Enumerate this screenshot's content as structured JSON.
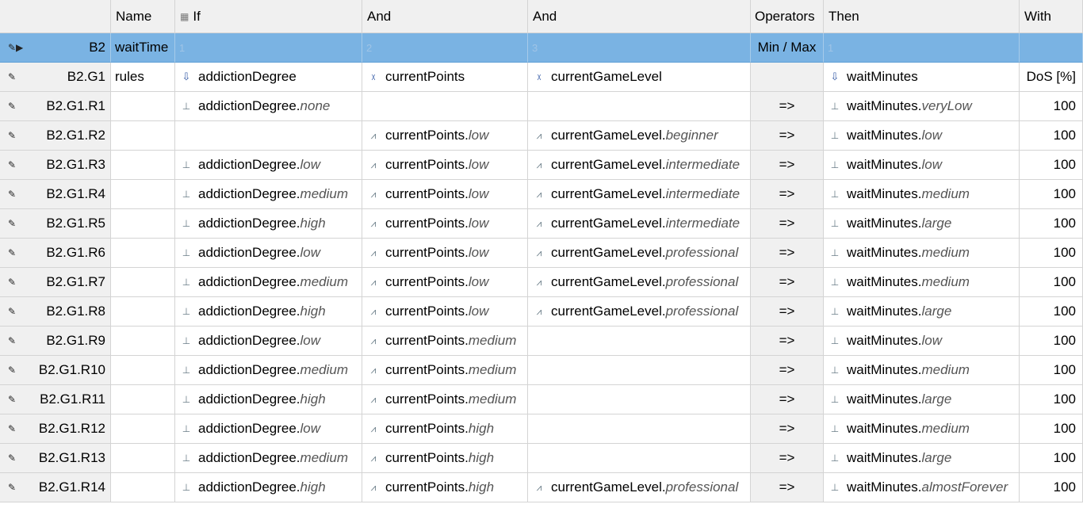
{
  "columns": {
    "name": "Name",
    "if": "If",
    "and1": "And",
    "and2": "And",
    "operators": "Operators",
    "then": "Then",
    "with": "With"
  },
  "block": {
    "id": "B2",
    "name": "waitTime",
    "if_num": "1",
    "and1_num": "2",
    "and2_num": "3",
    "operator": "Min / Max",
    "then_num": "1"
  },
  "group": {
    "id": "B2.G1",
    "name": "rules",
    "if_var": "addictionDegree",
    "and1_var": "currentPoints",
    "and2_var": "currentGameLevel",
    "then_var": "waitMinutes",
    "with_label": "DoS [%]"
  },
  "icons": {
    "edit": "pencil-icon",
    "current_row": "current-row-arrow-icon",
    "input_variable": "input-variable-icon",
    "fuzzy_variable": "fuzzy-variable-icon",
    "term": "membership-function-icon",
    "column_grip": "column-grip-icon"
  },
  "rules": [
    {
      "id": "B2.G1.R1",
      "c_if": "addictionDegree.",
      "t_if": "none",
      "c_a1": "",
      "t_a1": "",
      "c_a2": "",
      "t_a2": "",
      "op": "=>",
      "c_then": "waitMinutes.",
      "t_then": "veryLow",
      "dos": "100"
    },
    {
      "id": "B2.G1.R2",
      "c_if": "",
      "t_if": "",
      "c_a1": "currentPoints.",
      "t_a1": "low",
      "c_a2": "currentGameLevel.",
      "t_a2": "beginner",
      "op": "=>",
      "c_then": "waitMinutes.",
      "t_then": "low",
      "dos": "100"
    },
    {
      "id": "B2.G1.R3",
      "c_if": "addictionDegree.",
      "t_if": "low",
      "c_a1": "currentPoints.",
      "t_a1": "low",
      "c_a2": "currentGameLevel.",
      "t_a2": "intermediate",
      "op": "=>",
      "c_then": "waitMinutes.",
      "t_then": "low",
      "dos": "100"
    },
    {
      "id": "B2.G1.R4",
      "c_if": "addictionDegree.",
      "t_if": "medium",
      "c_a1": "currentPoints.",
      "t_a1": "low",
      "c_a2": "currentGameLevel.",
      "t_a2": "intermediate",
      "op": "=>",
      "c_then": "waitMinutes.",
      "t_then": "medium",
      "dos": "100"
    },
    {
      "id": "B2.G1.R5",
      "c_if": "addictionDegree.",
      "t_if": "high",
      "c_a1": "currentPoints.",
      "t_a1": "low",
      "c_a2": "currentGameLevel.",
      "t_a2": "intermediate",
      "op": "=>",
      "c_then": "waitMinutes.",
      "t_then": "large",
      "dos": "100"
    },
    {
      "id": "B2.G1.R6",
      "c_if": "addictionDegree.",
      "t_if": "low",
      "c_a1": "currentPoints.",
      "t_a1": "low",
      "c_a2": "currentGameLevel.",
      "t_a2": "professional",
      "op": "=>",
      "c_then": "waitMinutes.",
      "t_then": "medium",
      "dos": "100"
    },
    {
      "id": "B2.G1.R7",
      "c_if": "addictionDegree.",
      "t_if": "medium",
      "c_a1": "currentPoints.",
      "t_a1": "low",
      "c_a2": "currentGameLevel.",
      "t_a2": "professional",
      "op": "=>",
      "c_then": "waitMinutes.",
      "t_then": "medium",
      "dos": "100"
    },
    {
      "id": "B2.G1.R8",
      "c_if": "addictionDegree.",
      "t_if": "high",
      "c_a1": "currentPoints.",
      "t_a1": "low",
      "c_a2": "currentGameLevel.",
      "t_a2": "professional",
      "op": "=>",
      "c_then": "waitMinutes.",
      "t_then": "large",
      "dos": "100"
    },
    {
      "id": "B2.G1.R9",
      "c_if": "addictionDegree.",
      "t_if": "low",
      "c_a1": "currentPoints.",
      "t_a1": "medium",
      "c_a2": "",
      "t_a2": "",
      "op": "=>",
      "c_then": "waitMinutes.",
      "t_then": "low",
      "dos": "100"
    },
    {
      "id": "B2.G1.R10",
      "c_if": "addictionDegree.",
      "t_if": "medium",
      "c_a1": "currentPoints.",
      "t_a1": "medium",
      "c_a2": "",
      "t_a2": "",
      "op": "=>",
      "c_then": "waitMinutes.",
      "t_then": "medium",
      "dos": "100"
    },
    {
      "id": "B2.G1.R11",
      "c_if": "addictionDegree.",
      "t_if": "high",
      "c_a1": "currentPoints.",
      "t_a1": "medium",
      "c_a2": "",
      "t_a2": "",
      "op": "=>",
      "c_then": "waitMinutes.",
      "t_then": "large",
      "dos": "100"
    },
    {
      "id": "B2.G1.R12",
      "c_if": "addictionDegree.",
      "t_if": "low",
      "c_a1": "currentPoints.",
      "t_a1": "high",
      "c_a2": "",
      "t_a2": "",
      "op": "=>",
      "c_then": "waitMinutes.",
      "t_then": "medium",
      "dos": "100"
    },
    {
      "id": "B2.G1.R13",
      "c_if": "addictionDegree.",
      "t_if": "medium",
      "c_a1": "currentPoints.",
      "t_a1": "high",
      "c_a2": "",
      "t_a2": "",
      "op": "=>",
      "c_then": "waitMinutes.",
      "t_then": "large",
      "dos": "100"
    },
    {
      "id": "B2.G1.R14",
      "c_if": "addictionDegree.",
      "t_if": "high",
      "c_a1": "currentPoints.",
      "t_a1": "high",
      "c_a2": "currentGameLevel.",
      "t_a2": "professional",
      "op": "=>",
      "c_then": "waitMinutes.",
      "t_then": "almostForever",
      "dos": "100"
    }
  ],
  "colors": {
    "selected_row": "#7ab3e3",
    "header_bg": "#f0f0f0",
    "grid_line": "#d4d4d4",
    "term_text": "#555555"
  }
}
